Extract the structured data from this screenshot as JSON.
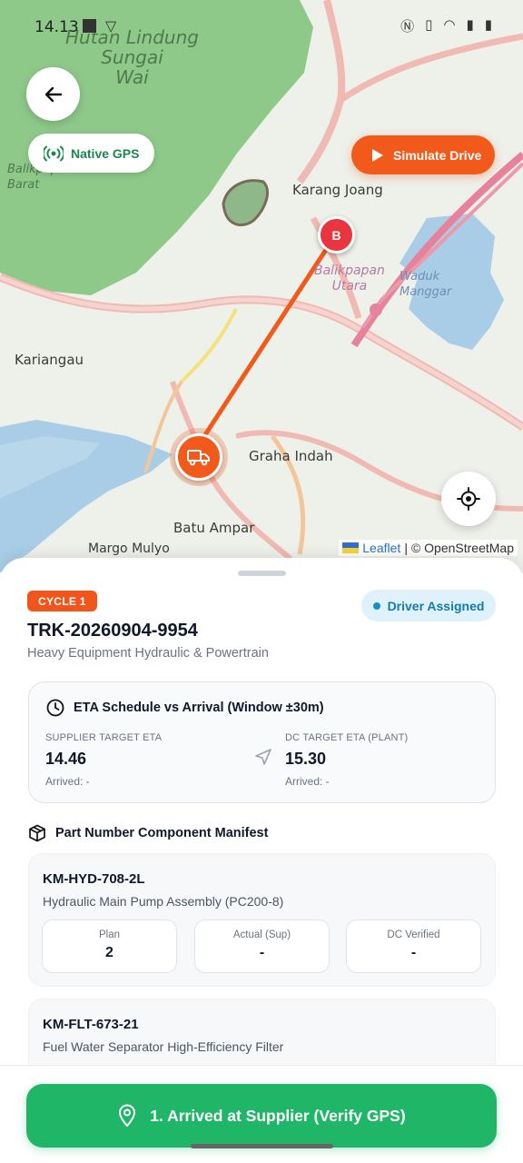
{
  "status_bar": {
    "time": "14.13"
  },
  "map": {
    "labels": {
      "forest": "Hutan Lindung\nSungai\nWai",
      "karang_joang": "Karang Joang",
      "balikpapan_utara": "Balikpapan\nUtara",
      "waduk_manggar": "Waduk\nManggar",
      "kariangau": "Kariangau",
      "graha_indah": "Graha Indah",
      "batu_ampar": "Batu Ampar",
      "margo_mulyo": "Margo Mulyo",
      "balikpapan_barat": "Balikpapan\nBarat"
    },
    "gps_label": "Native GPS",
    "simulate_label": "Simulate Drive",
    "marker_b": "B",
    "attribution": {
      "leaflet": "Leaflet",
      "sep": "|",
      "osm": "© OpenStreetMap"
    },
    "colors": {
      "accent": "#f25a1b",
      "marker_b": "#e8353e",
      "forest": "#8ec98a",
      "water": "#a9cde6"
    }
  },
  "sheet": {
    "cycle": "CYCLE 1",
    "status": "Driver Assigned",
    "truck_id": "TRK-20260904-9954",
    "description": "Heavy Equipment Hydraulic & Powertrain",
    "eta": {
      "title": "ETA Schedule vs Arrival (Window ±30m)",
      "supplier_label": "SUPPLIER TARGET ETA",
      "supplier_value": "14.46",
      "supplier_arrived": "Arrived: -",
      "dc_label": "DC TARGET ETA (PLANT)",
      "dc_value": "15.30",
      "dc_arrived": "Arrived: -"
    },
    "manifest_title": "Part Number Component Manifest",
    "parts": [
      {
        "pn": "KM-HYD-708-2L",
        "desc": "Hydraulic Main Pump Assembly (PC200-8)",
        "qty": [
          {
            "label": "Plan",
            "value": "2"
          },
          {
            "label": "Actual (Sup)",
            "value": "-"
          },
          {
            "label": "DC Verified",
            "value": "-"
          }
        ]
      },
      {
        "pn": "KM-FLT-673-21",
        "desc": "Fuel Water Separator High-Efficiency Filter"
      }
    ]
  },
  "footer": {
    "primary_label": "1. Arrived at Supplier (Verify GPS)"
  }
}
